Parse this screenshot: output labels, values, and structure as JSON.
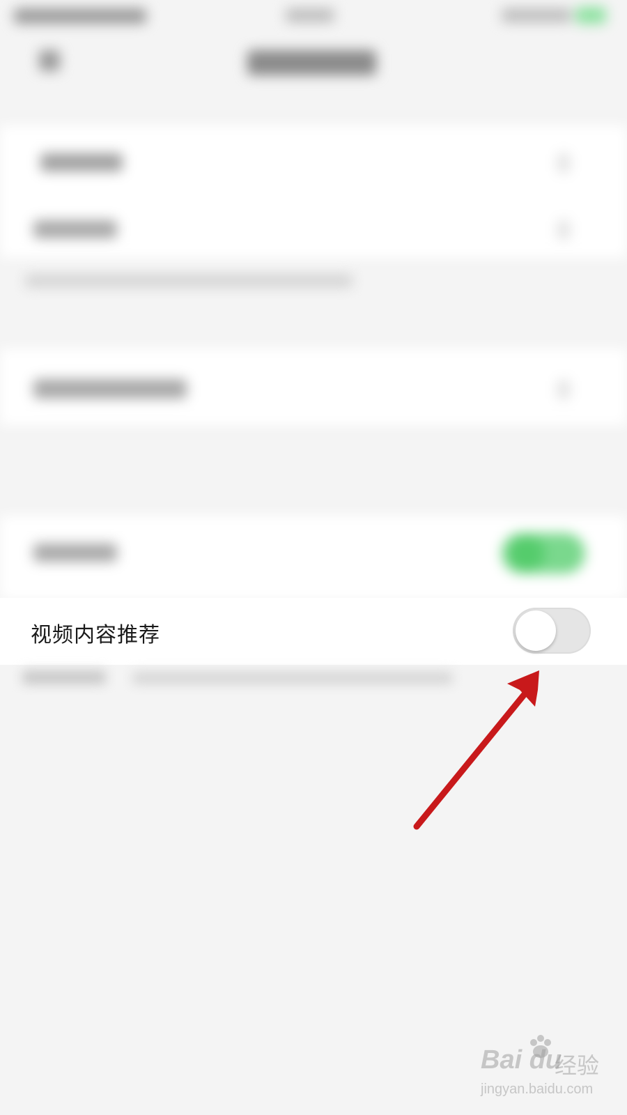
{
  "settings": {
    "video_recommend_label": "视频内容推荐",
    "video_recommend_enabled": false
  },
  "watermark": {
    "logo": "Bai du",
    "logo_cn": "经验",
    "url": "jingyan.baidu.com"
  },
  "colors": {
    "background": "#f4f4f4",
    "row_background": "#ffffff",
    "toggle_off": "#e5e5e5",
    "toggle_on_blurred": "#5fd07a",
    "arrow": "#c8191b"
  },
  "icons": {
    "back": "back-arrow-icon",
    "annotation": "red-arrow-annotation-icon"
  }
}
